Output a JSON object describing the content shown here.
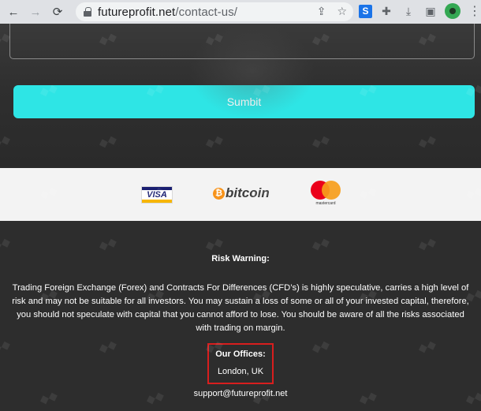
{
  "browser": {
    "url_host": "futureprofit.net",
    "url_path": "/contact-us/",
    "back_glyph": "←",
    "forward_glyph": "→",
    "reload_glyph": "⟳"
  },
  "form": {
    "submit_label": "Sumbit"
  },
  "payments": {
    "visa_label": "VISA",
    "bitcoin_symbol": "₿",
    "bitcoin_label": "bitcoin",
    "mastercard_label": "mastercard"
  },
  "footer": {
    "risk_title": "Risk Warning:",
    "risk_text": "Trading Foreign Exchange (Forex) and Contracts For Differences (CFD’s) is highly speculative, carries a high level of risk and may not be suitable for all investors. You may sustain a loss of some or all of your invested capital, therefore, you should not speculate with capital that you cannot afford to lose. You should be aware of all the risks associated with trading on margin.",
    "offices_title": "Our Offices:",
    "offices_city": "London, UK",
    "email": "support@futureprofit.net"
  },
  "colors": {
    "submit_bg": "#2ee5e5",
    "page_bg": "#2d2d2d",
    "highlight_box": "#d81e1e"
  }
}
